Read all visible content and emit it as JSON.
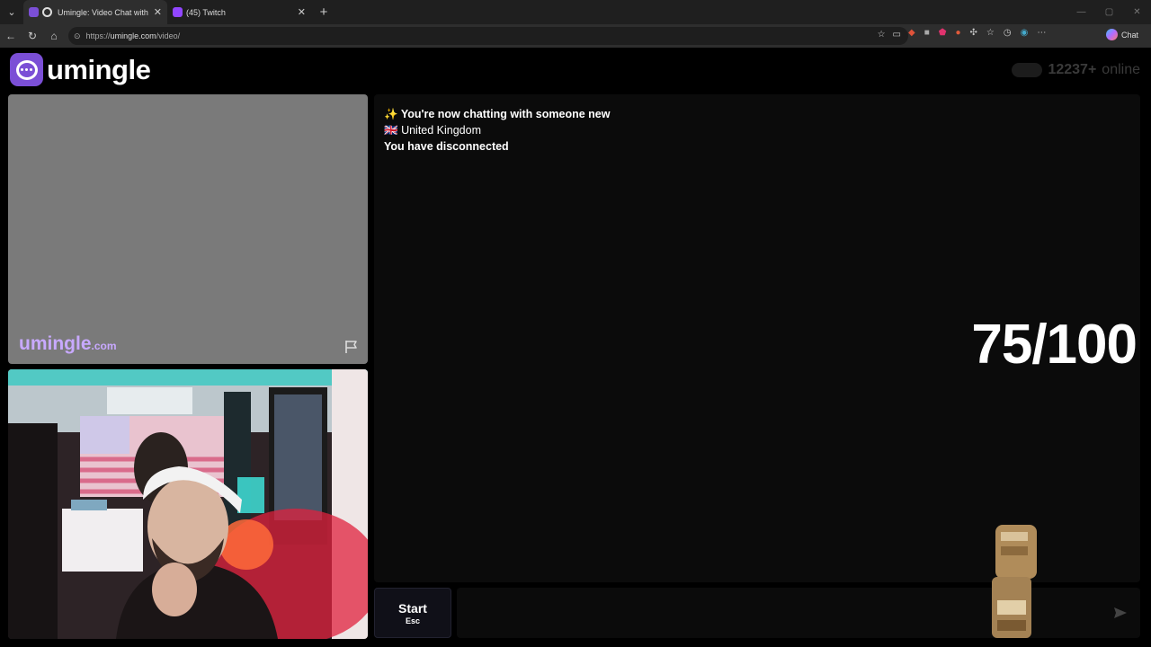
{
  "browser": {
    "tabs": [
      {
        "title": "Umingle: Video Chat with Stra",
        "active": true
      },
      {
        "title": "(45) Twitch",
        "active": false
      }
    ],
    "url_prefix": "https://",
    "url_host": "umingle.com",
    "url_path": "/video/",
    "chat_label": "Chat"
  },
  "site": {
    "logo_text": "umingle",
    "online_count": "12237+",
    "online_label": "online"
  },
  "stranger": {
    "watermark_main": "umingle",
    "watermark_suffix": ".com"
  },
  "chat": {
    "messages": [
      {
        "icon": "✨",
        "text": "You're now chatting with someone new",
        "bold": true
      },
      {
        "icon": "🇬🇧",
        "text": "United Kingdom",
        "bold": false
      },
      {
        "icon": "",
        "text": "You have disconnected",
        "bold": true
      }
    ],
    "overlay_score": "75/100"
  },
  "controls": {
    "start_label": "Start",
    "start_hint": "Esc"
  },
  "colors": {
    "brand": "#7b4fd6",
    "watermark": "#c8a9ff"
  }
}
